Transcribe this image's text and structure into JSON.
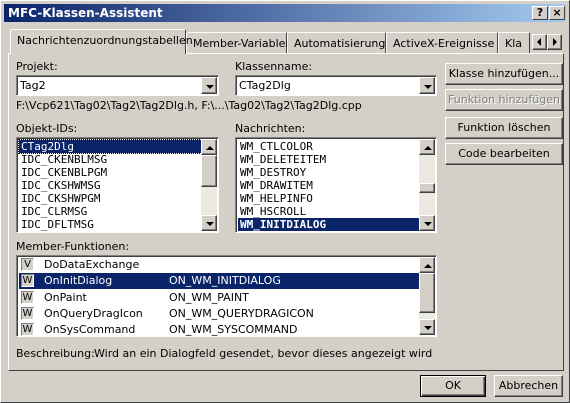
{
  "window": {
    "title": "MFC-Klassen-Assistent",
    "help_label": "?",
    "close_label": "×"
  },
  "tabs": [
    {
      "label": "Nachrichtenzuordnungstabellen"
    },
    {
      "label": "Member-Variablen"
    },
    {
      "label": "Automatisierung"
    },
    {
      "label": "ActiveX-Ereignisse"
    },
    {
      "label": "Kla"
    }
  ],
  "project": {
    "label": "Projekt:",
    "value": "Tag2"
  },
  "classname": {
    "label": "Klassenname:",
    "value": "CTag2Dlg"
  },
  "filepath": "F:\\Vcp621\\Tag02\\Tag2\\Tag2Dlg.h, F:\\...\\Tag02\\Tag2\\Tag2Dlg.cpp",
  "object_ids": {
    "label": "Objekt-IDs:",
    "items": [
      "CTag2Dlg",
      "IDC_CKENBLMSG",
      "IDC_CKENBLPGM",
      "IDC_CKSHWMSG",
      "IDC_CKSHWPGM",
      "IDC_CLRMSG",
      "IDC_DFLTMSG"
    ],
    "selected": 0
  },
  "messages": {
    "label": "Nachrichten:",
    "items": [
      "WM_CTLCOLOR",
      "WM_DELETEITEM",
      "WM_DESTROY",
      "WM_DRAWITEM",
      "WM_HELPINFO",
      "WM_HSCROLL",
      "WM_INITDIALOG"
    ],
    "selected": 6
  },
  "member_functions": {
    "label": "Member-Funktionen:",
    "rows": [
      {
        "badge": "V",
        "name": "DoDataExchange",
        "handler": ""
      },
      {
        "badge": "W",
        "name": "OnInitDialog",
        "handler": "ON_WM_INITDIALOG"
      },
      {
        "badge": "W",
        "name": "OnPaint",
        "handler": "ON_WM_PAINT"
      },
      {
        "badge": "W",
        "name": "OnQueryDragIcon",
        "handler": "ON_WM_QUERYDRAGICON"
      },
      {
        "badge": "W",
        "name": "OnSysCommand",
        "handler": "ON_WM_SYSCOMMAND"
      }
    ],
    "selected": 1
  },
  "description": {
    "label": "Beschreibung:",
    "text": "Wird an ein Dialogfeld gesendet, bevor dieses angezeigt wird"
  },
  "buttons": {
    "add_class": "Klasse hinzufügen...",
    "add_function": "Funktion hinzufügen",
    "delete_function": "Funktion löschen",
    "edit_code": "Code bearbeiten",
    "ok": "OK",
    "cancel": "Abbrechen"
  }
}
